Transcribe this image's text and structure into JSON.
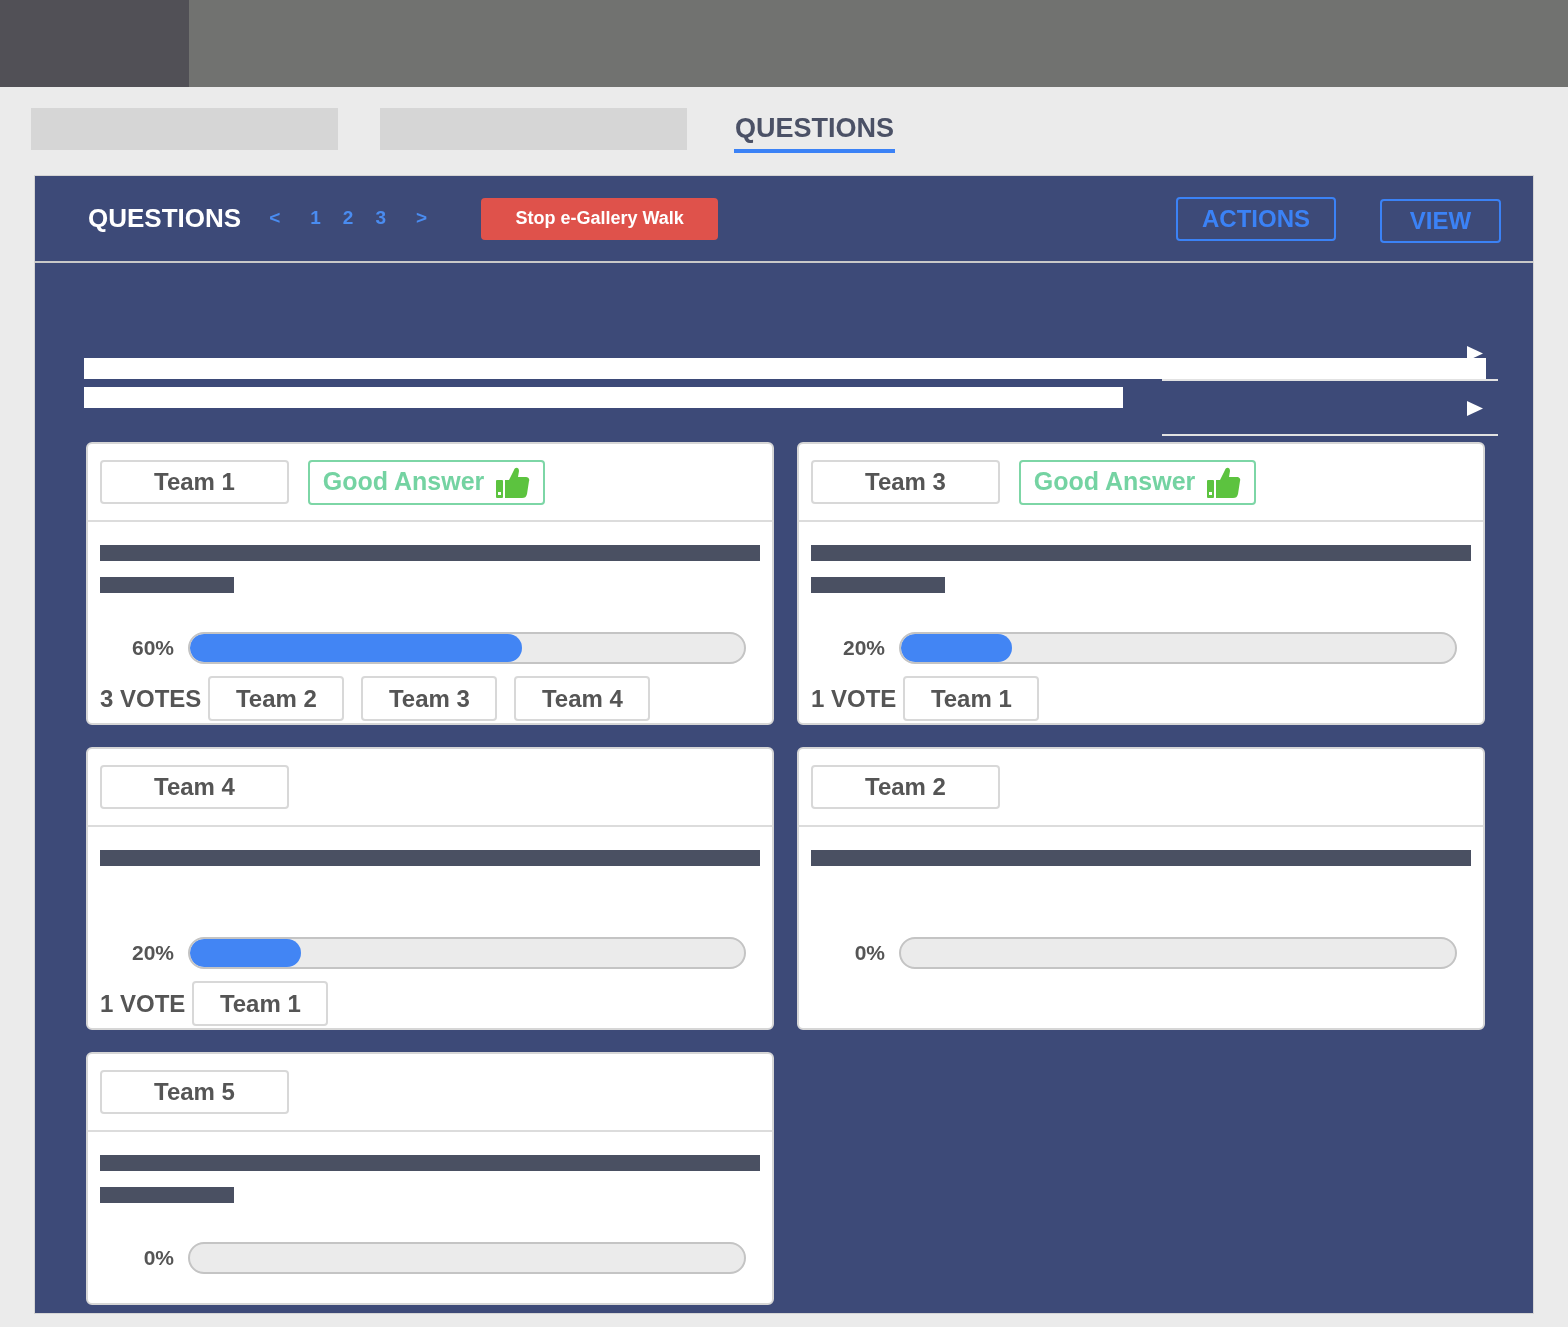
{
  "tabs": [
    {
      "kind": "blank",
      "selected": false
    },
    {
      "kind": "blank",
      "selected": false
    },
    {
      "kind": "text",
      "label": "QUESTIONS",
      "selected": true
    }
  ],
  "panel": {
    "title": "QUESTIONS",
    "pagination": {
      "prev": "<",
      "pages": [
        "1",
        "2",
        "3"
      ],
      "next": ">"
    },
    "stop_button": "Stop e-Gallery Walk",
    "buttons": [
      "ACTIONS",
      "VIEW"
    ]
  },
  "cards": [
    {
      "team": "Team 1",
      "badge": "Good Answer",
      "two_line_answer": true,
      "percent": "60%",
      "level": 0.6,
      "votes": "3 VOTES",
      "voters": [
        "Team 2",
        "Team 3",
        "Team 4"
      ]
    },
    {
      "team": "Team 3",
      "badge": "Good Answer",
      "two_line_answer": true,
      "percent": "20%",
      "level": 0.2,
      "votes": "1 VOTE",
      "voters": [
        "Team 1"
      ]
    },
    {
      "team": "Team 4",
      "two_line_answer": false,
      "percent": "20%",
      "level": 0.2,
      "votes": "1 VOTE",
      "voters": [
        "Team 1"
      ]
    },
    {
      "team": "Team 2",
      "two_line_answer": false,
      "percent": "0%"
    },
    {
      "team": "Team 5",
      "two_line_answer": true,
      "percent": "0%"
    }
  ]
}
